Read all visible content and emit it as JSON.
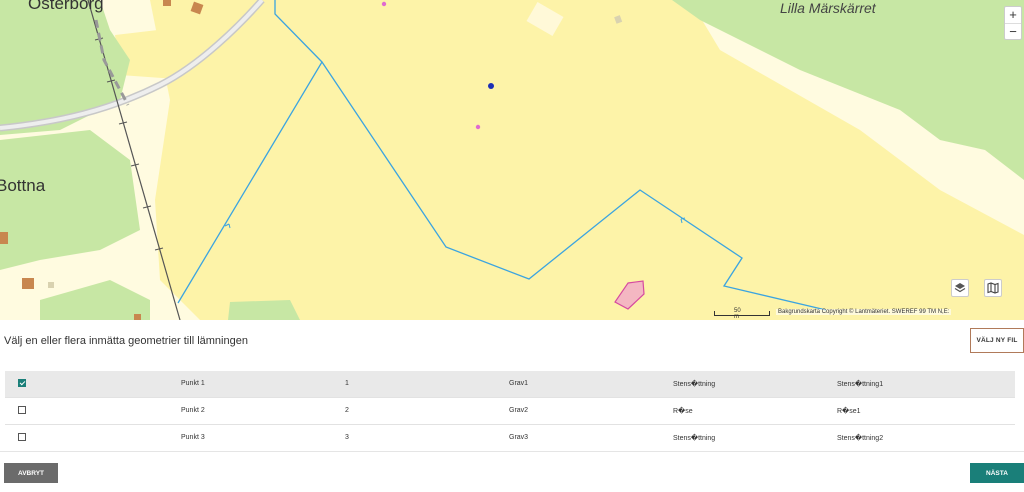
{
  "map": {
    "labels": {
      "osterborg": "Österborg",
      "bottna": "Bottna",
      "lilla_marskarret": "Lilla Märskärret"
    },
    "zoom_in": "+",
    "zoom_out": "−",
    "scale_label": "50 m",
    "copyright": "Bakgrundskarta Copyright © Lantmäteriet. SWEREF 99 TM N,E:",
    "colors": {
      "field": "#fdf6b8",
      "forest": "#c7e7a4",
      "polygon_line": "#3ba4e0",
      "road": "#c8c8c8",
      "railway": "#555555",
      "building": "#c8874f",
      "marker_dark": "#1c2fb5",
      "marker_pink": "#e06ad0",
      "feature_fill": "#f4b7c2",
      "feature_stroke": "#d64aa0"
    },
    "icons": [
      "layers-icon",
      "map-icon"
    ]
  },
  "panel": {
    "title": "Välj en eller flera inmätta geometrier till lämningen",
    "select_file_label": "VÄLJ NY FIL",
    "rows": [
      {
        "checked": true,
        "name": "Punkt 1",
        "num": "1",
        "type": "Grav1",
        "sub": "Stens�ttning",
        "ext": "Stens�ttning1"
      },
      {
        "checked": false,
        "name": "Punkt 2",
        "num": "2",
        "type": "Grav2",
        "sub": "R�se",
        "ext": "R�se1"
      },
      {
        "checked": false,
        "name": "Punkt 3",
        "num": "3",
        "type": "Grav3",
        "sub": "Stens�ttning",
        "ext": "Stens�ttning2"
      }
    ],
    "cancel_label": "AVBRYT",
    "next_label": "NÄSTA",
    "colors": {
      "primary": "#1a7f79",
      "secondary": "#6b6b6b",
      "outline": "#b07a5a"
    }
  }
}
